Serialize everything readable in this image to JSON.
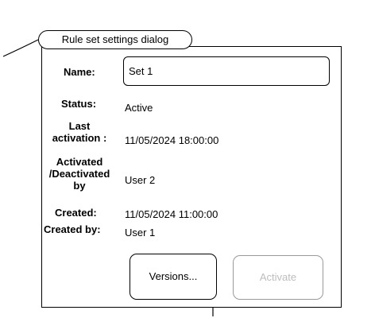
{
  "dialog": {
    "title": "Rule set settings dialog",
    "name_label": "Name:",
    "name_value": "Set 1",
    "status_label": "Status:",
    "status_value": "Active",
    "last_activation_label_line1": "Last",
    "last_activation_label_line2": "activation :",
    "last_activation_value": "11/05/2024 18:00:00",
    "activated_label_line1": "Activated",
    "activated_label_line2": "/Deactivated",
    "activated_label_line3": "by",
    "activated_value": "User 2",
    "created_label": "Created:",
    "created_value": "11/05/2024 11:00:00",
    "created_by_label": "Created by:",
    "created_by_value": "User 1",
    "versions_button": "Versions...",
    "activate_button": "Activate"
  }
}
